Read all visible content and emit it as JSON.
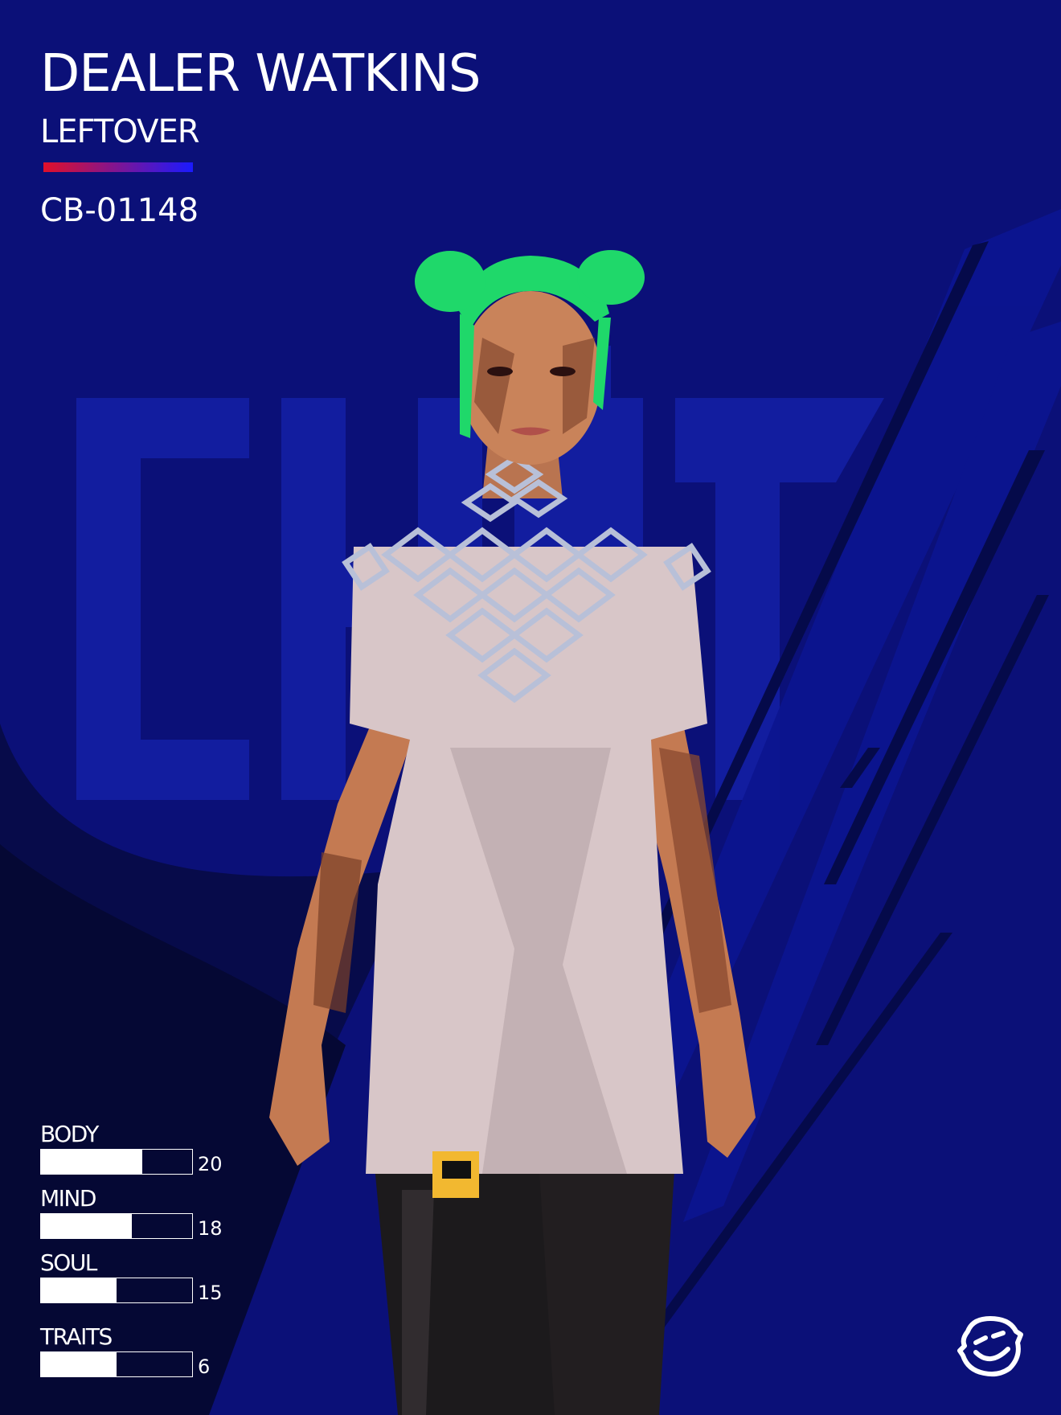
{
  "card": {
    "name": "DEALER WATKINS",
    "faction": "LEFTOVER",
    "serial": "CB-01148",
    "colors": {
      "background": "#0b1078",
      "accent_start": "#e0102a",
      "accent_end": "#1a1aff",
      "hair": "#1fd86a",
      "dress": "#d8c6c8"
    }
  },
  "stats": [
    {
      "label": "BODY",
      "value": "20",
      "fill_fraction": 0.67
    },
    {
      "label": "MIND",
      "value": "18",
      "fill_fraction": 0.6
    },
    {
      "label": "SOUL",
      "value": "15",
      "fill_fraction": 0.5
    }
  ],
  "traits": {
    "label": "TRAITS",
    "value": "6",
    "fill_fraction": 0.5
  },
  "logo": {
    "icon": "smiley-logo-icon"
  }
}
